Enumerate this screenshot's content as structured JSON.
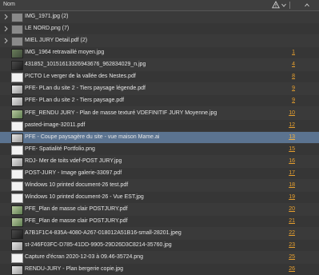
{
  "header": {
    "name_label": "Nom"
  },
  "rows": [
    {
      "name": "IMG_1971.jpg (2)",
      "page": "",
      "kind": "folder",
      "expand": true
    },
    {
      "name": "LE NORD.png (7)",
      "page": "",
      "kind": "folder",
      "expand": true
    },
    {
      "name": "MIEL JURY  Detail.pdf (2)",
      "page": "",
      "kind": "folder",
      "expand": true
    },
    {
      "name": "IMG_1964 retravaillé moyen.jpg",
      "page": "1",
      "kind": "pic",
      "expand": false
    },
    {
      "name": "431852_10151613326943676_962834029_n.jpg",
      "page": "4",
      "kind": "dark",
      "expand": false
    },
    {
      "name": "PICTO Le verger de la vallée des Nestes.pdf",
      "page": "8",
      "kind": "doc",
      "expand": false
    },
    {
      "name": "PFE- PLan du site 2 - Tiers paysage légende.pdf",
      "page": "9",
      "kind": "light",
      "expand": false
    },
    {
      "name": "PFE- PLan du site 2 - Tiers paysage.pdf",
      "page": "9",
      "kind": "light",
      "expand": false
    },
    {
      "name": "PFE_RENDU JURY - Plan de masse texturé VDEFINITIF JURY Moyenne.jpg",
      "page": "10",
      "kind": "plan",
      "expand": false
    },
    {
      "name": "pasted-image-32011.pdf",
      "page": "12",
      "kind": "doc",
      "expand": false
    },
    {
      "name": "PFE - Coupe paysagère du site - vue maison Mame.ai",
      "page": "13",
      "kind": "light",
      "expand": false
    },
    {
      "name": "PFE- Spatialité Portfolio.png",
      "page": "15",
      "kind": "doc",
      "expand": false
    },
    {
      "name": "RDJ- Mer de toits vdef-POST JURY.jpg",
      "page": "16",
      "kind": "light",
      "expand": false
    },
    {
      "name": "POST-JURY - Image galerie-33097.pdf",
      "page": "17",
      "kind": "doc",
      "expand": false
    },
    {
      "name": "Windows 10 printed document-26 test.pdf",
      "page": "18",
      "kind": "doc",
      "expand": false
    },
    {
      "name": "Windows 10 printed document-26 - Vue EST.jpg",
      "page": "19",
      "kind": "doc",
      "expand": false
    },
    {
      "name": "PFE_Plan de masse clair POSTJURY.pdf",
      "page": "20",
      "kind": "plan",
      "expand": false
    },
    {
      "name": "PFE_Plan de masse clair POSTJURY.pdf",
      "page": "21",
      "kind": "plan",
      "expand": false
    },
    {
      "name": "A7B1F1C4-835A-4080-A267-018012A51B16-small-28201.jpeg",
      "page": "22",
      "kind": "dark",
      "expand": false
    },
    {
      "name": "st-246F03FC-D785-41DD-9905-29D26D3C8214-35760.jpg",
      "page": "23",
      "kind": "light",
      "expand": false
    },
    {
      "name": "Capture d'écran 2020-12-03 à 09.46-35724.png",
      "page": "25",
      "kind": "doc",
      "expand": false
    },
    {
      "name": "RENDU-JURY - Plan bergerie  copie.jpg",
      "page": "26",
      "kind": "light",
      "expand": false
    }
  ],
  "selected_index": 10,
  "colors": {
    "page_link": "#e8a02e",
    "selection": "#5b7390"
  }
}
